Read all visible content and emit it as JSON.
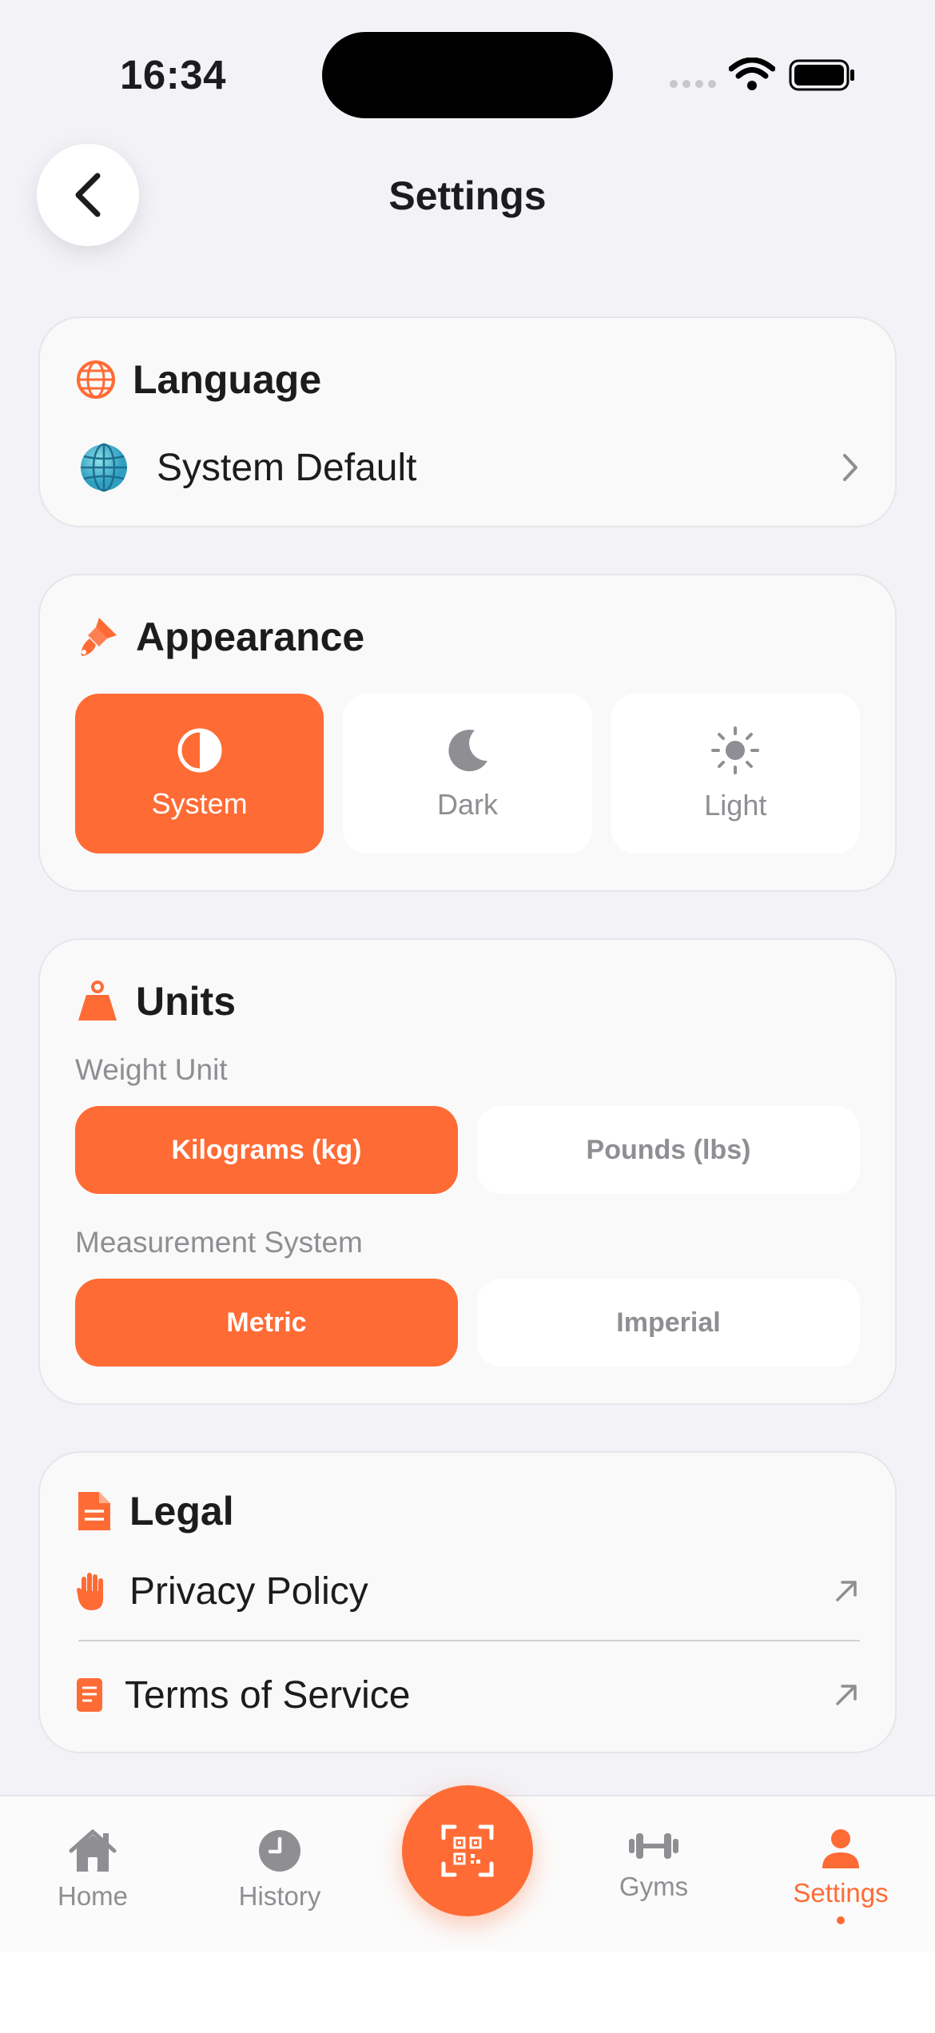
{
  "status_bar": {
    "time": "16:34"
  },
  "header": {
    "title": "Settings"
  },
  "language": {
    "title": "Language",
    "value": "System Default"
  },
  "appearance": {
    "title": "Appearance",
    "options": [
      {
        "label": "System",
        "icon": "half-circle-icon",
        "selected": true
      },
      {
        "label": "Dark",
        "icon": "moon-icon",
        "selected": false
      },
      {
        "label": "Light",
        "icon": "sun-icon",
        "selected": false
      }
    ]
  },
  "units": {
    "title": "Units",
    "weight_label": "Weight Unit",
    "weight_options": [
      {
        "label": "Kilograms (kg)",
        "selected": true
      },
      {
        "label": "Pounds (lbs)",
        "selected": false
      }
    ],
    "measurement_label": "Measurement System",
    "measurement_options": [
      {
        "label": "Metric",
        "selected": true
      },
      {
        "label": "Imperial",
        "selected": false
      }
    ]
  },
  "legal": {
    "title": "Legal",
    "items": [
      {
        "label": "Privacy Policy"
      },
      {
        "label": "Terms of Service"
      }
    ]
  },
  "tabbar": {
    "items": [
      {
        "label": "Home",
        "icon": "house-icon"
      },
      {
        "label": "History",
        "icon": "clock-icon"
      },
      {
        "label": "Gyms",
        "icon": "dumbbell-icon"
      },
      {
        "label": "Settings",
        "icon": "person-icon",
        "active": true
      }
    ]
  },
  "colors": {
    "accent": "#ff6b35",
    "background": "#f2f2f7",
    "muted": "#8e8e93"
  }
}
